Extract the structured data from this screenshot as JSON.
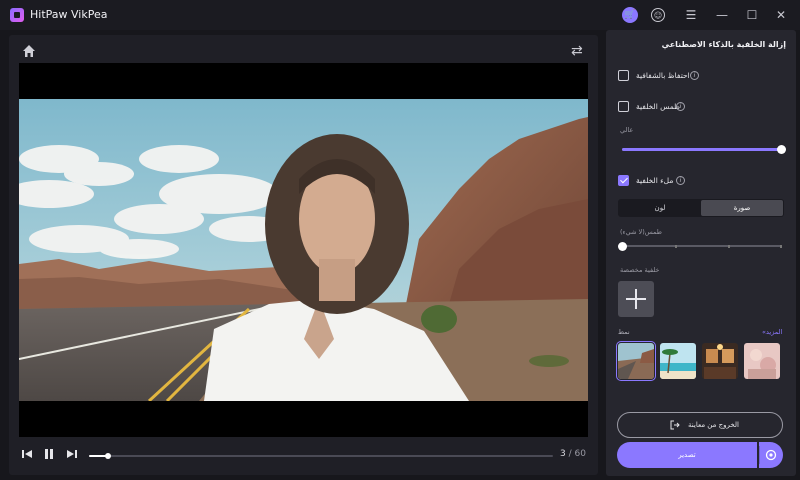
{
  "app": {
    "title": "HitPaw VikPea"
  },
  "panel": {
    "title": "إزالة الخلفية بالذكاء الاصطناعي",
    "keep_transparency": "احتفاظ بالشفافية",
    "blur_background": "طمس الخلفية",
    "blur_level_label": "عالي",
    "blur_level": 1.0,
    "fill_background": "ملء الخلفية",
    "tabs": {
      "color": "لون",
      "image": "صورة",
      "selected": "image"
    },
    "image_blur_label": "طمس(لا شيء)",
    "image_blur_level": 0.0,
    "custom_background_label": "خلفية مخصصة",
    "more_link": "المزيد»",
    "pattern_label": "نمط",
    "exit_preview": "الخروج من معاينة",
    "export": "تصدير"
  },
  "player": {
    "current_frame": "3",
    "total_frames": "/ 60",
    "progress": 0.04
  },
  "colors": {
    "accent": "#8b78ff",
    "panel": "#26262e",
    "background": "#17171c"
  }
}
